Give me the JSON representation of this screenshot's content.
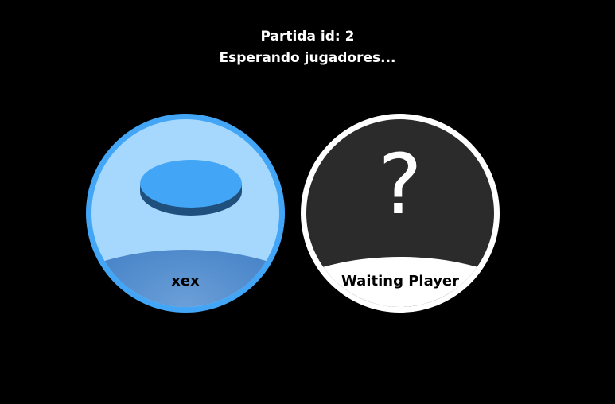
{
  "header": {
    "line1": "Partida id: 2",
    "line2": "Esperando jugadores..."
  },
  "players": [
    {
      "name": "xex",
      "status": "joined",
      "token_icon": "blue-disc-token-icon",
      "colors": {
        "ring": "#42a5f5",
        "background": "#a6d8fe",
        "token_top": "#42a5f5",
        "token_side": "#1f4f7d"
      }
    },
    {
      "name": "Waiting Player",
      "status": "waiting",
      "placeholder_glyph": "?",
      "colors": {
        "ring": "#ffffff",
        "background": "#2b2b2b"
      }
    }
  ]
}
